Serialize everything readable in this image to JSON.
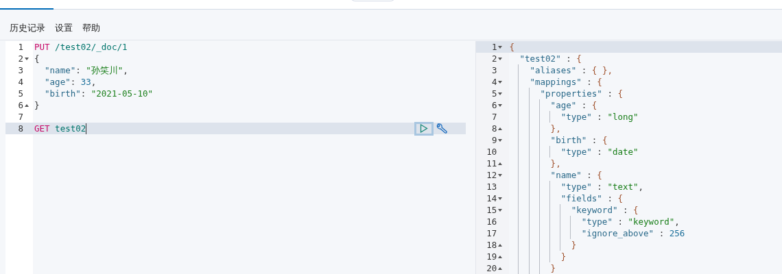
{
  "menu": [
    {
      "label": "历史记录"
    },
    {
      "label": "设置"
    },
    {
      "label": "帮助"
    }
  ],
  "request_editor": {
    "lines": [
      {
        "number": "1",
        "active": false,
        "tokens": [
          {
            "t": "PUT",
            "kind": "method"
          },
          {
            "t": " /test02/_doc/1",
            "kind": "url"
          }
        ]
      },
      {
        "number": "2",
        "fold_start": true,
        "active": false,
        "tokens": [
          {
            "t": "{",
            "kind": "punct"
          }
        ]
      },
      {
        "number": "3",
        "active": false,
        "tokens": [
          {
            "t": "  \"name\"",
            "kind": "key"
          },
          {
            "t": ": ",
            "kind": "punct"
          },
          {
            "t": "\"孙笑川\"",
            "kind": "string"
          },
          {
            "t": ",",
            "kind": "punct"
          }
        ]
      },
      {
        "number": "4",
        "active": false,
        "tokens": [
          {
            "t": "  \"age\"",
            "kind": "key"
          },
          {
            "t": ": ",
            "kind": "punct"
          },
          {
            "t": "33",
            "kind": "number"
          },
          {
            "t": ",",
            "kind": "punct"
          }
        ]
      },
      {
        "number": "5",
        "active": false,
        "tokens": [
          {
            "t": "  \"birth\"",
            "kind": "key"
          },
          {
            "t": ": ",
            "kind": "punct"
          },
          {
            "t": "\"2021-05-10\"",
            "kind": "string"
          }
        ]
      },
      {
        "number": "6",
        "fold_end": true,
        "active": false,
        "tokens": [
          {
            "t": "}",
            "kind": "punct"
          }
        ]
      },
      {
        "number": "7",
        "active": false
      },
      {
        "number": "8",
        "active": true,
        "tokens": [
          {
            "t": "GET",
            "kind": "method"
          },
          {
            "t": " test02",
            "kind": "url"
          }
        ]
      }
    ]
  },
  "response_editor": {
    "lines": [
      {
        "number": "1",
        "fold_start": true,
        "active": true,
        "tokens": [
          {
            "t": "{",
            "kind": "brace"
          }
        ]
      },
      {
        "number": "2",
        "fold_start": true,
        "active": false,
        "tokens": [
          {
            "t": "  \"test02\"",
            "kind": "key"
          },
          {
            "t": " : ",
            "kind": "punct"
          },
          {
            "t": "{",
            "kind": "brace"
          }
        ]
      },
      {
        "number": "3",
        "active": false,
        "tokens": [
          {
            "t": "    \"aliases\"",
            "kind": "key"
          },
          {
            "t": " : ",
            "kind": "punct"
          },
          {
            "t": "{ },",
            "kind": "brace"
          }
        ]
      },
      {
        "number": "4",
        "fold_start": true,
        "active": false,
        "tokens": [
          {
            "t": "    \"mappings\"",
            "kind": "key"
          },
          {
            "t": " : ",
            "kind": "punct"
          },
          {
            "t": "{",
            "kind": "brace"
          }
        ]
      },
      {
        "number": "5",
        "fold_start": true,
        "active": false,
        "tokens": [
          {
            "t": "      \"properties\"",
            "kind": "key"
          },
          {
            "t": " : ",
            "kind": "punct"
          },
          {
            "t": "{",
            "kind": "brace"
          }
        ]
      },
      {
        "number": "6",
        "fold_start": true,
        "active": false,
        "tokens": [
          {
            "t": "        \"age\"",
            "kind": "key"
          },
          {
            "t": " : ",
            "kind": "punct"
          },
          {
            "t": "{",
            "kind": "brace"
          }
        ]
      },
      {
        "number": "7",
        "active": false,
        "tokens": [
          {
            "t": "          \"type\"",
            "kind": "key"
          },
          {
            "t": " : ",
            "kind": "punct"
          },
          {
            "t": "\"long\"",
            "kind": "string"
          }
        ]
      },
      {
        "number": "8",
        "fold_end": true,
        "active": false,
        "tokens": [
          {
            "t": "        },",
            "kind": "brace"
          }
        ]
      },
      {
        "number": "9",
        "fold_start": true,
        "active": false,
        "tokens": [
          {
            "t": "        \"birth\"",
            "kind": "key"
          },
          {
            "t": " : ",
            "kind": "punct"
          },
          {
            "t": "{",
            "kind": "brace"
          }
        ]
      },
      {
        "number": "10",
        "active": false,
        "tokens": [
          {
            "t": "          \"type\"",
            "kind": "key"
          },
          {
            "t": " : ",
            "kind": "punct"
          },
          {
            "t": "\"date\"",
            "kind": "string"
          }
        ]
      },
      {
        "number": "11",
        "fold_end": true,
        "active": false,
        "tokens": [
          {
            "t": "        },",
            "kind": "brace"
          }
        ]
      },
      {
        "number": "12",
        "fold_start": true,
        "active": false,
        "tokens": [
          {
            "t": "        \"name\"",
            "kind": "key"
          },
          {
            "t": " : ",
            "kind": "punct"
          },
          {
            "t": "{",
            "kind": "brace"
          }
        ]
      },
      {
        "number": "13",
        "active": false,
        "tokens": [
          {
            "t": "          \"type\"",
            "kind": "key"
          },
          {
            "t": " : ",
            "kind": "punct"
          },
          {
            "t": "\"text\"",
            "kind": "string"
          },
          {
            "t": ",",
            "kind": "punct"
          }
        ]
      },
      {
        "number": "14",
        "fold_start": true,
        "active": false,
        "tokens": [
          {
            "t": "          \"fields\"",
            "kind": "key"
          },
          {
            "t": " : ",
            "kind": "punct"
          },
          {
            "t": "{",
            "kind": "brace"
          }
        ]
      },
      {
        "number": "15",
        "fold_start": true,
        "active": false,
        "tokens": [
          {
            "t": "            \"keyword\"",
            "kind": "key"
          },
          {
            "t": " : ",
            "kind": "punct"
          },
          {
            "t": "{",
            "kind": "brace"
          }
        ]
      },
      {
        "number": "16",
        "active": false,
        "tokens": [
          {
            "t": "              \"type\"",
            "kind": "key"
          },
          {
            "t": " : ",
            "kind": "punct"
          },
          {
            "t": "\"keyword\"",
            "kind": "string"
          },
          {
            "t": ",",
            "kind": "punct"
          }
        ]
      },
      {
        "number": "17",
        "active": false,
        "tokens": [
          {
            "t": "              \"ignore_above\"",
            "kind": "key"
          },
          {
            "t": " : ",
            "kind": "punct"
          },
          {
            "t": "256",
            "kind": "number"
          }
        ]
      },
      {
        "number": "18",
        "fold_end": true,
        "active": false,
        "tokens": [
          {
            "t": "            }",
            "kind": "brace"
          }
        ]
      },
      {
        "number": "19",
        "fold_end": true,
        "active": false,
        "tokens": [
          {
            "t": "          }",
            "kind": "brace"
          }
        ]
      },
      {
        "number": "20",
        "fold_end": true,
        "active": false,
        "tokens": [
          {
            "t": "        }",
            "kind": "brace"
          }
        ]
      }
    ]
  }
}
